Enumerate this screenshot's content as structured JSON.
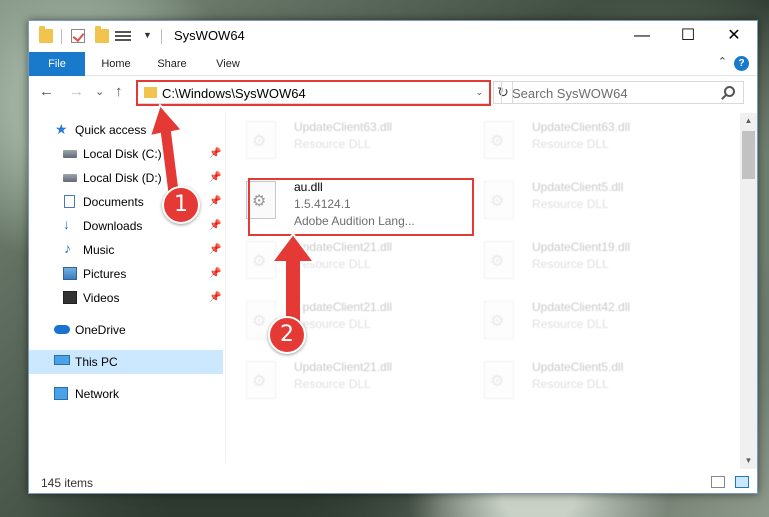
{
  "window": {
    "title": "SysWOW64",
    "minimize": "—",
    "maximize": "☐",
    "close": "✕"
  },
  "ribbon": {
    "tabs": [
      "File",
      "Home",
      "Share",
      "View"
    ],
    "help": "?",
    "collapse": "⌃"
  },
  "address": {
    "back": "←",
    "forward": "→",
    "recent": "⌄",
    "up": "↑",
    "path": "C:\\Windows\\SysWOW64",
    "dropdown": "⌄",
    "refresh": "↻",
    "search_placeholder": "Search SysWOW64"
  },
  "sidebar": {
    "items": [
      {
        "label": "Quick access",
        "icon": "star-icon",
        "pinned": false
      },
      {
        "label": "Local Disk (C:)",
        "icon": "disk-icon",
        "pinned": true
      },
      {
        "label": "Local Disk (D:)",
        "icon": "disk-icon",
        "pinned": true
      },
      {
        "label": "Documents",
        "icon": "document-icon",
        "pinned": true
      },
      {
        "label": "Downloads",
        "icon": "download-icon",
        "pinned": true
      },
      {
        "label": "Music",
        "icon": "music-icon",
        "pinned": true
      },
      {
        "label": "Pictures",
        "icon": "pictures-icon",
        "pinned": true
      },
      {
        "label": "Videos",
        "icon": "videos-icon",
        "pinned": true
      },
      {
        "label": "OneDrive",
        "icon": "cloud-icon",
        "pinned": false
      },
      {
        "label": "This PC",
        "icon": "computer-icon",
        "pinned": false,
        "selected": true
      },
      {
        "label": "Network",
        "icon": "network-icon",
        "pinned": false
      }
    ],
    "pin_glyph": "📌"
  },
  "files": [
    {
      "name": "UpdateClient63.dll",
      "type": "Resource DLL",
      "faded": true
    },
    {
      "name": "UpdateClient63.dll",
      "type": "Resource DLL",
      "faded": true
    },
    {
      "name": "au.dll",
      "version": "1.5.4124.1",
      "description": "Adobe Audition Lang...",
      "faded": false
    },
    {
      "name": "UpdateClient5.dll",
      "type": "Resource DLL",
      "faded": true
    },
    {
      "name": "UpdateClient21.dll",
      "type": "Resource DLL",
      "faded": true
    },
    {
      "name": "UpdateClient19.dll",
      "type": "Resource DLL",
      "faded": true
    },
    {
      "name": "UpdateClient21.dll",
      "type": "Resource DLL",
      "faded": true
    },
    {
      "name": "UpdateClient42.dll",
      "type": "Resource DLL",
      "faded": true
    },
    {
      "name": "UpdateClient21.dll",
      "type": "Resource DLL",
      "faded": true
    },
    {
      "name": "UpdateClient5.dll",
      "type": "Resource DLL",
      "faded": true
    }
  ],
  "scroll": {
    "up": "▲",
    "down": "▼"
  },
  "status": {
    "item_count": "145 items"
  },
  "annotations": {
    "step1": "1",
    "step2": "2",
    "accent": "#e53935"
  }
}
